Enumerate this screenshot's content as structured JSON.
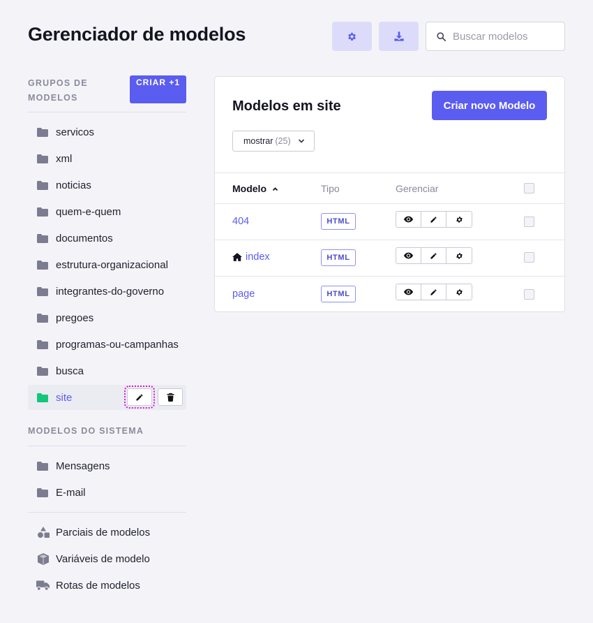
{
  "header": {
    "title": "Gerenciador de modelos",
    "settings_icon": "gear-icon",
    "download_icon": "download-icon",
    "search_placeholder": "Buscar modelos"
  },
  "sidebar": {
    "groups_heading": "GRUPOS DE MODELOS",
    "create_label": "CRIAR +1",
    "groups": [
      {
        "label": "servicos"
      },
      {
        "label": "xml"
      },
      {
        "label": "noticias"
      },
      {
        "label": "quem-e-quem"
      },
      {
        "label": "documentos"
      },
      {
        "label": "estrutura-organizacional"
      },
      {
        "label": "integrantes-do-governo"
      },
      {
        "label": "pregoes"
      },
      {
        "label": "programas-ou-campanhas"
      },
      {
        "label": "busca"
      },
      {
        "label": "site",
        "active": true
      }
    ],
    "system_heading": "MODELOS DO SISTEMA",
    "system_groups": [
      {
        "label": "Mensagens"
      },
      {
        "label": "E-mail"
      }
    ],
    "extras": [
      {
        "label": "Parciais de modelos",
        "icon": "shapes-icon"
      },
      {
        "label": "Variáveis de modelo",
        "icon": "cube-icon"
      },
      {
        "label": "Rotas de modelos",
        "icon": "truck-icon"
      }
    ]
  },
  "main": {
    "title": "Modelos em site",
    "create_button": "Criar novo Modelo",
    "show_label": "mostrar",
    "show_count": "(25)",
    "columns": {
      "name": "Modelo",
      "type": "Tipo",
      "manage": "Gerenciar"
    },
    "rows": [
      {
        "name": "404",
        "type": "HTML",
        "home": false
      },
      {
        "name": "index",
        "type": "HTML",
        "home": true
      },
      {
        "name": "page",
        "type": "HTML",
        "home": false
      }
    ]
  },
  "colors": {
    "accent": "#5b5cf0",
    "active_folder": "#12c77a",
    "folder": "#7c7c90",
    "focus_outline": "#d81bd8"
  }
}
